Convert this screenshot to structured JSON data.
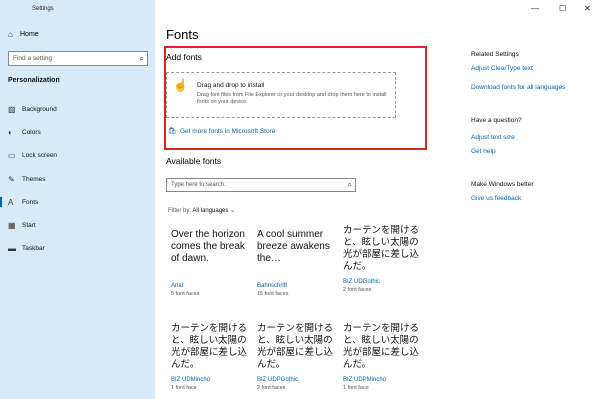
{
  "sidebar": {
    "app_title": "Settings",
    "home_label": "Home",
    "search_placeholder": "Find a setting",
    "section": "Personalization",
    "items": [
      {
        "label": "Background",
        "icon": "picture-icon"
      },
      {
        "label": "Colors",
        "icon": "palette-icon"
      },
      {
        "label": "Lock screen",
        "icon": "lock-screen-icon"
      },
      {
        "label": "Themes",
        "icon": "brush-icon"
      },
      {
        "label": "Fonts",
        "icon": "font-icon",
        "active": true
      },
      {
        "label": "Start",
        "icon": "start-icon"
      },
      {
        "label": "Taskbar",
        "icon": "taskbar-icon"
      }
    ]
  },
  "window": {
    "minimize": "—",
    "maximize": "☐",
    "close": "✕"
  },
  "main": {
    "title": "Fonts",
    "add_fonts": {
      "title": "Add fonts",
      "drop_title": "Drag and drop to install",
      "drop_desc": "Drag font files from File Explorer or your desktop and drop them here to install fonts on your device.",
      "store_link": "Get more fonts in Microsoft Store"
    },
    "available": {
      "title": "Available fonts",
      "search_placeholder": "Type here to search.",
      "filter_label": "Filter by:",
      "filter_value": "All languages"
    },
    "fonts": [
      {
        "sample": "Over the horizon comes the break of dawn.",
        "name": "Arial",
        "faces": "5 font faces"
      },
      {
        "sample": "A cool summer breeze awakens the…",
        "name": "Bahnschrift",
        "faces": "15 font faces"
      },
      {
        "sample": "カーテンを開けると、眩しい太陽の光が部屋に差し込んだ。",
        "name": "BIZ UDGothic",
        "faces": "2 font faces"
      },
      {
        "sample": "カーテンを開けると、眩しい太陽の光が部屋に差し込んだ。",
        "name": "BIZ UDMincho",
        "faces": "1 font face"
      },
      {
        "sample": "カーテンを開けると、眩しい太陽の光が部屋に差し込んだ。",
        "name": "BIZ UDPGothic",
        "faces": "2 font faces"
      },
      {
        "sample": "カーテンを開けると、眩しい太陽の光が部屋に差し込んだ。",
        "name": "BIZ UDPMincho",
        "faces": "1 font face"
      }
    ]
  },
  "related": {
    "title": "Related Settings",
    "links": [
      "Adjust ClearType text",
      "Download fonts for all languages"
    ],
    "question_title": "Have a question?",
    "question_links": [
      "Adjust text size",
      "Get help"
    ],
    "better_title": "Make Windows better",
    "better_link": "Give us feedback"
  },
  "colors": {
    "accent": "#0063b1",
    "sidebar_bg": "#d6eaf9",
    "highlight_border": "#d9222a"
  }
}
